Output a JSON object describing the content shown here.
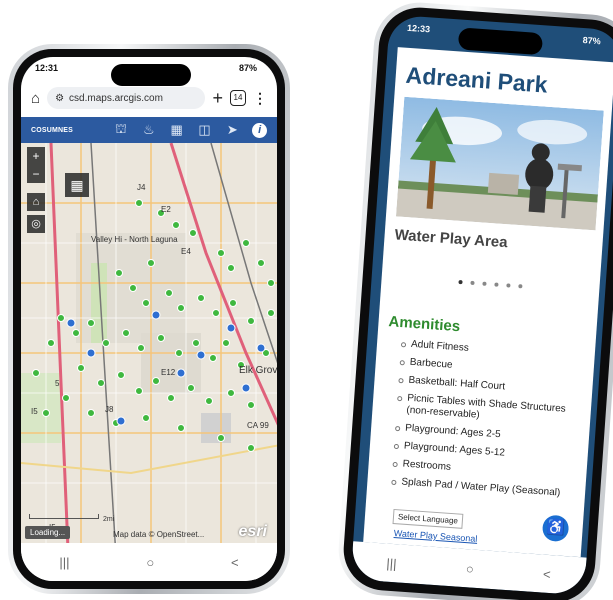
{
  "phone_map": {
    "status_time": "12:31",
    "status_right": "87%",
    "url": "csd.maps.arcgis.com",
    "tab_count": "14",
    "brand": "COSUMNES",
    "map_labels": {
      "valley_hi": "Valley Hi - North Laguna",
      "elk_grove": "Elk Grove",
      "e12": "E12",
      "j8": "J8",
      "i5a": "I5",
      "i5b": "I5",
      "ca99": "CA 99",
      "n5": "5",
      "j4": "J4",
      "e2": "E2",
      "e4": "E4",
      "scale": "2mi"
    },
    "loading_text": "Loading...",
    "attribution": "Map data © OpenStreet...",
    "esri": "esri",
    "nav": [
      "|||",
      "○",
      "<"
    ]
  },
  "phone_park": {
    "status_time": "12:33",
    "status_right": "87%",
    "title": "Adreani Park",
    "caption": "Water Play Area",
    "amenities_title": "Amenities",
    "amenities": [
      "Adult Fitness",
      "Barbecue",
      "Basketball: Half Court",
      "Picnic Tables with Shade Structures (non-reservable)",
      "Playground: Ages 2-5",
      "Playground: Ages 5-12",
      "Restrooms",
      "Splash Pad / Water Play (Seasonal)"
    ],
    "language": "Select Language",
    "water_link": "Water Play Seasonal",
    "nav": [
      "|||",
      "○",
      "<"
    ]
  },
  "colors": {
    "brand_blue": "#2c5aa0",
    "park_blue": "#1f4e79",
    "amenity_green": "#2e8b2e",
    "marker_green": "#3fb83f",
    "marker_blue": "#2f6fd1"
  }
}
